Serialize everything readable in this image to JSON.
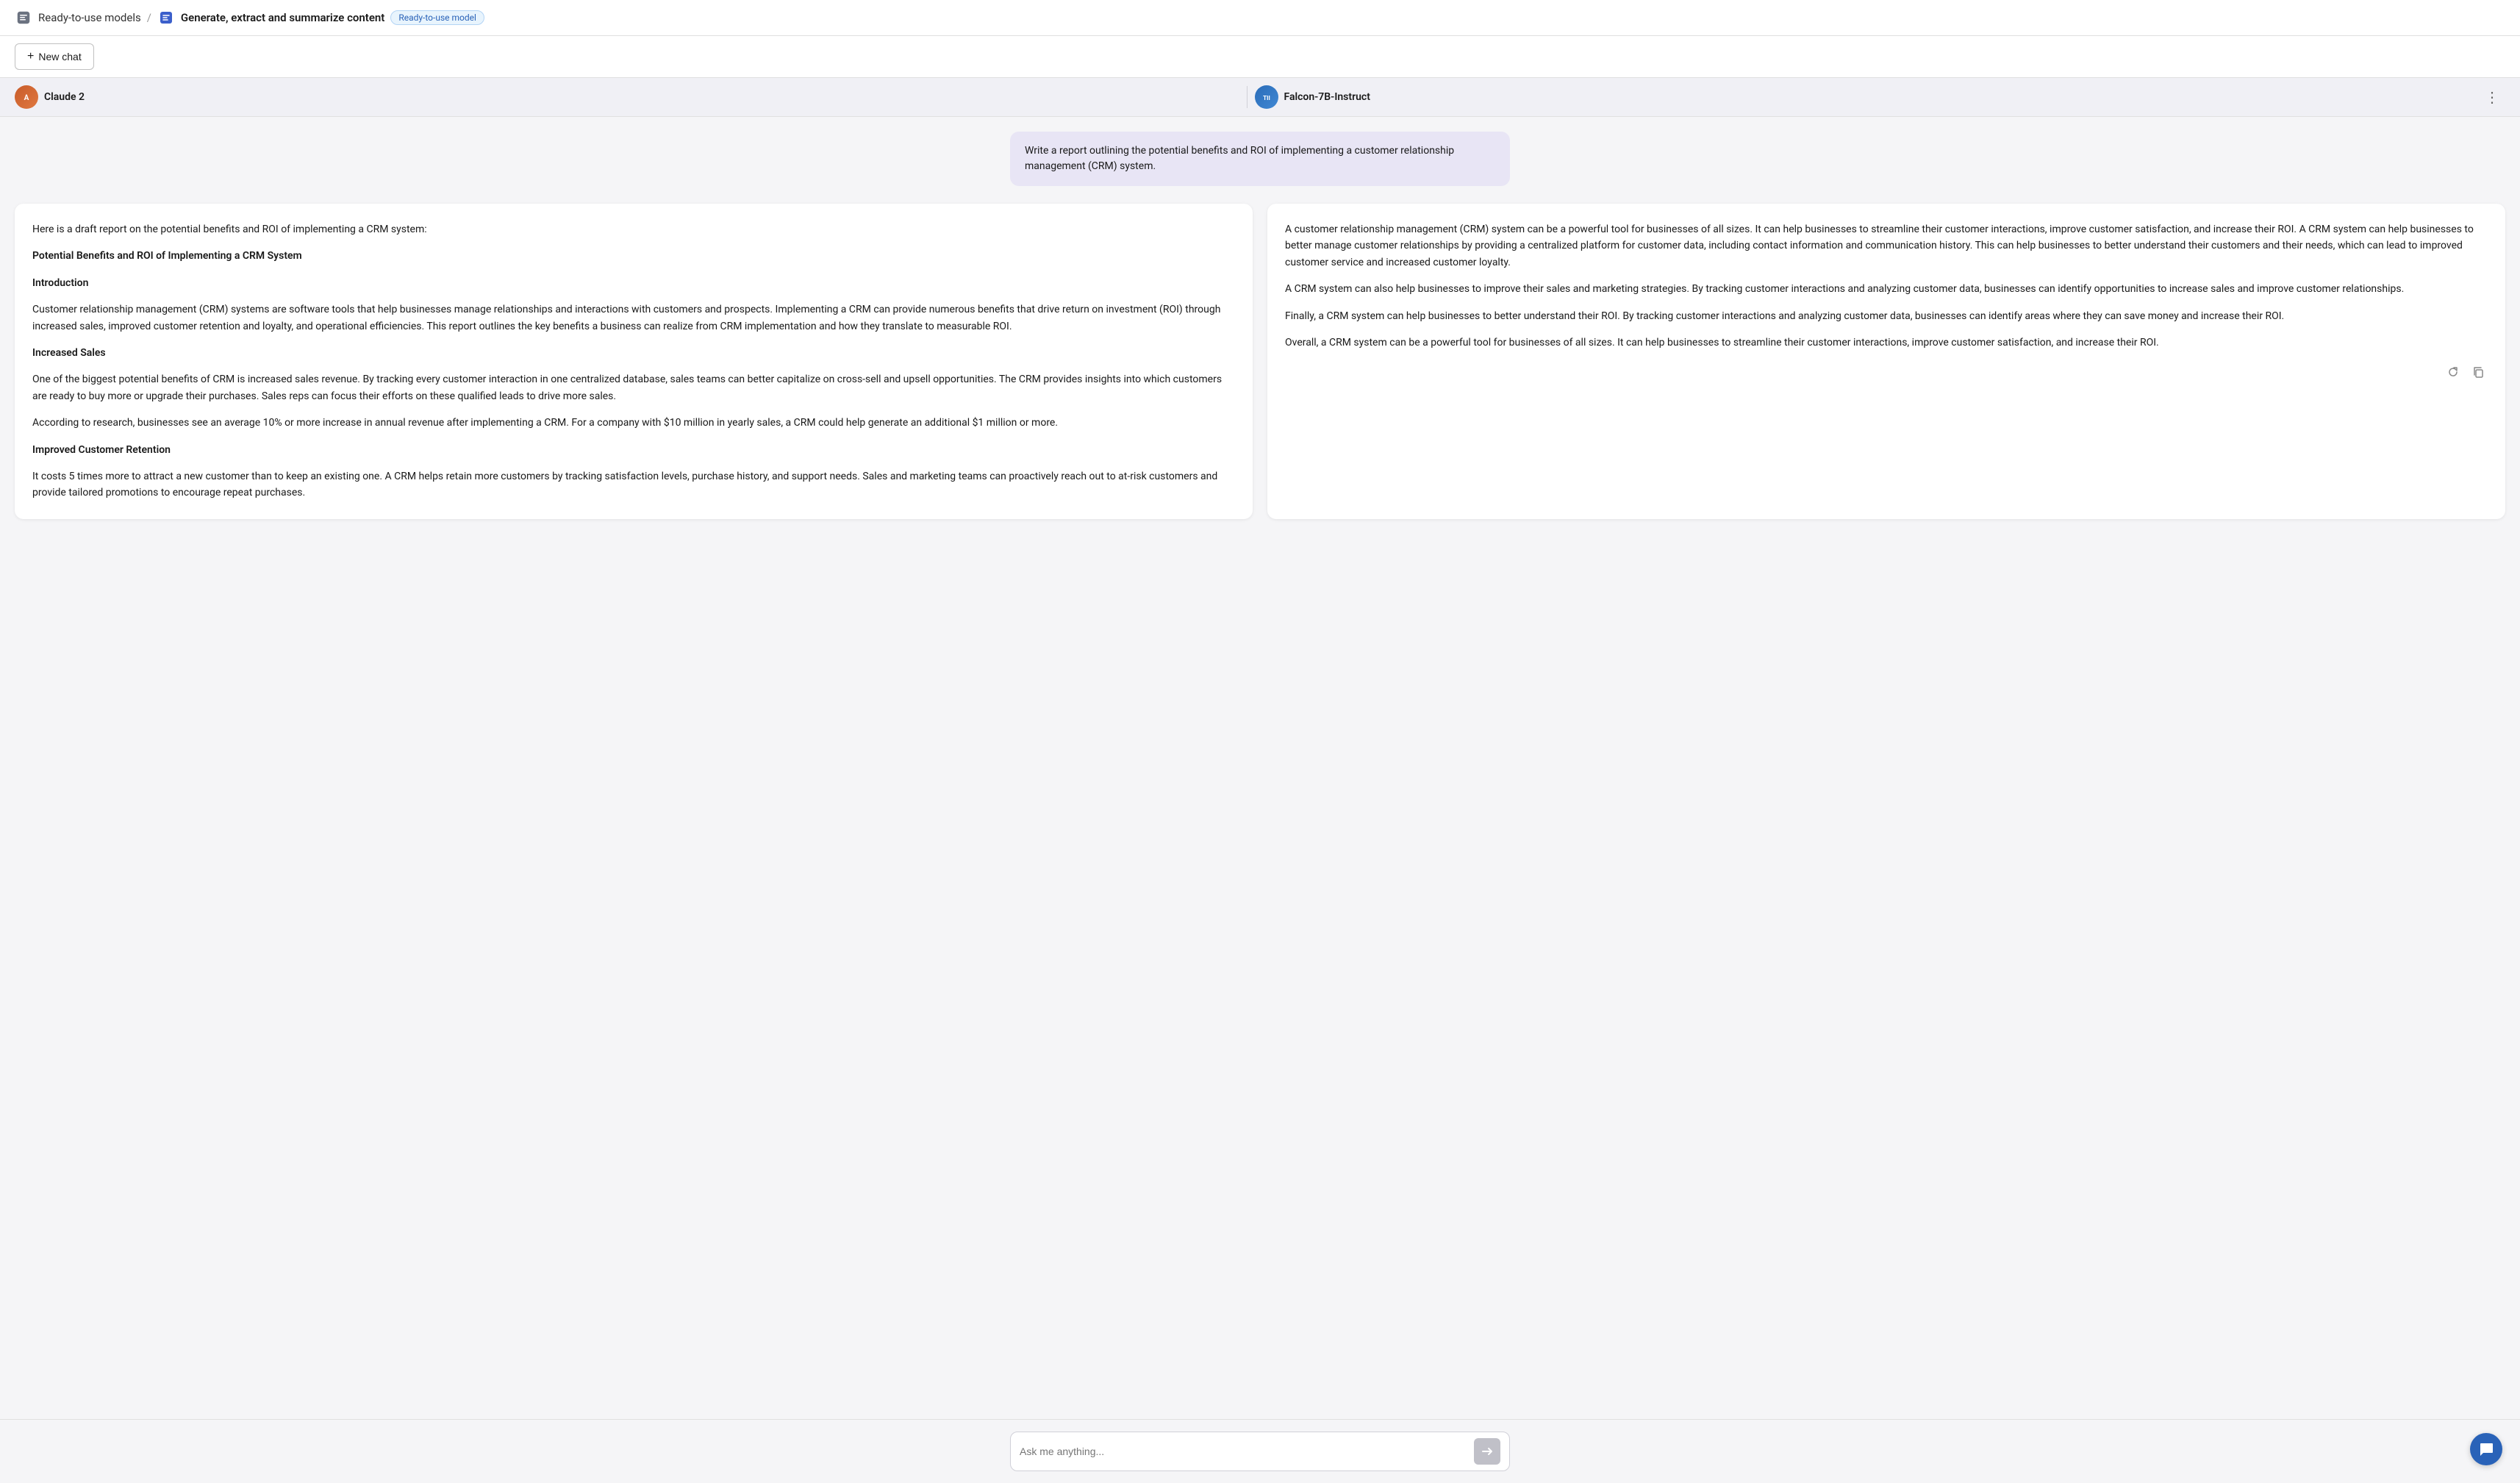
{
  "header": {
    "breadcrumb_icon": "⚙",
    "breadcrumb_text": "Ready-to-use models",
    "separator": "/",
    "page_icon": "💬",
    "page_title": "Generate, extract and summarize content",
    "badge": "Ready-to-use model"
  },
  "toolbar": {
    "new_chat_label": "New chat",
    "plus_icon": "+"
  },
  "models": {
    "left_name": "Claude 2",
    "right_name": "Falcon-7B-Instruct",
    "more_icon": "⋮"
  },
  "user_message": "Write a report outlining the potential benefits and ROI of implementing a customer relationship management (CRM) system.",
  "responses": {
    "left": {
      "paragraphs": [
        "Here is a draft report on the potential benefits and ROI of implementing a CRM system:",
        "Potential Benefits and ROI of Implementing a CRM System",
        "Introduction",
        "Customer relationship management (CRM) systems are software tools that help businesses manage relationships and interactions with customers and prospects. Implementing a CRM can provide numerous benefits that drive return on investment (ROI) through increased sales, improved customer retention and loyalty, and operational efficiencies. This report outlines the key benefits a business can realize from CRM implementation and how they translate to measurable ROI.",
        "Increased Sales",
        "One of the biggest potential benefits of CRM is increased sales revenue. By tracking every customer interaction in one centralized database, sales teams can better capitalize on cross-sell and upsell opportunities. The CRM provides insights into which customers are ready to buy more or upgrade their purchases. Sales reps can focus their efforts on these qualified leads to drive more sales.",
        "According to research, businesses see an average 10% or more increase in annual revenue after implementing a CRM. For a company with $10 million in yearly sales, a CRM could help generate an additional $1 million or more.",
        "Improved Customer Retention",
        "It costs 5 times more to attract a new customer than to keep an existing one. A CRM helps retain more customers by tracking satisfaction levels, purchase history, and support needs. Sales and marketing teams can proactively reach out to at-risk customers and provide tailored promotions to encourage repeat purchases."
      ]
    },
    "right": {
      "paragraphs": [
        "A customer relationship management (CRM) system can be a powerful tool for businesses of all sizes. It can help businesses to streamline their customer interactions, improve customer satisfaction, and increase their ROI. A CRM system can help businesses to better manage customer relationships by providing a centralized platform for customer data, including contact information and communication history. This can help businesses to better understand their customers and their needs, which can lead to improved customer service and increased customer loyalty.",
        "A CRM system can also help businesses to improve their sales and marketing strategies. By tracking customer interactions and analyzing customer data, businesses can identify opportunities to increase sales and improve customer relationships.",
        "Finally, a CRM system can help businesses to better understand their ROI. By tracking customer interactions and analyzing customer data, businesses can identify areas where they can save money and increase their ROI.",
        "Overall, a CRM system can be a powerful tool for businesses of all sizes. It can help businesses to streamline their customer interactions, improve customer satisfaction, and increase their ROI."
      ],
      "action_refresh": "↻",
      "action_copy": "⧉"
    }
  },
  "input": {
    "placeholder": "Ask me anything...",
    "send_icon": "▶"
  },
  "chat_bubble": "💬"
}
